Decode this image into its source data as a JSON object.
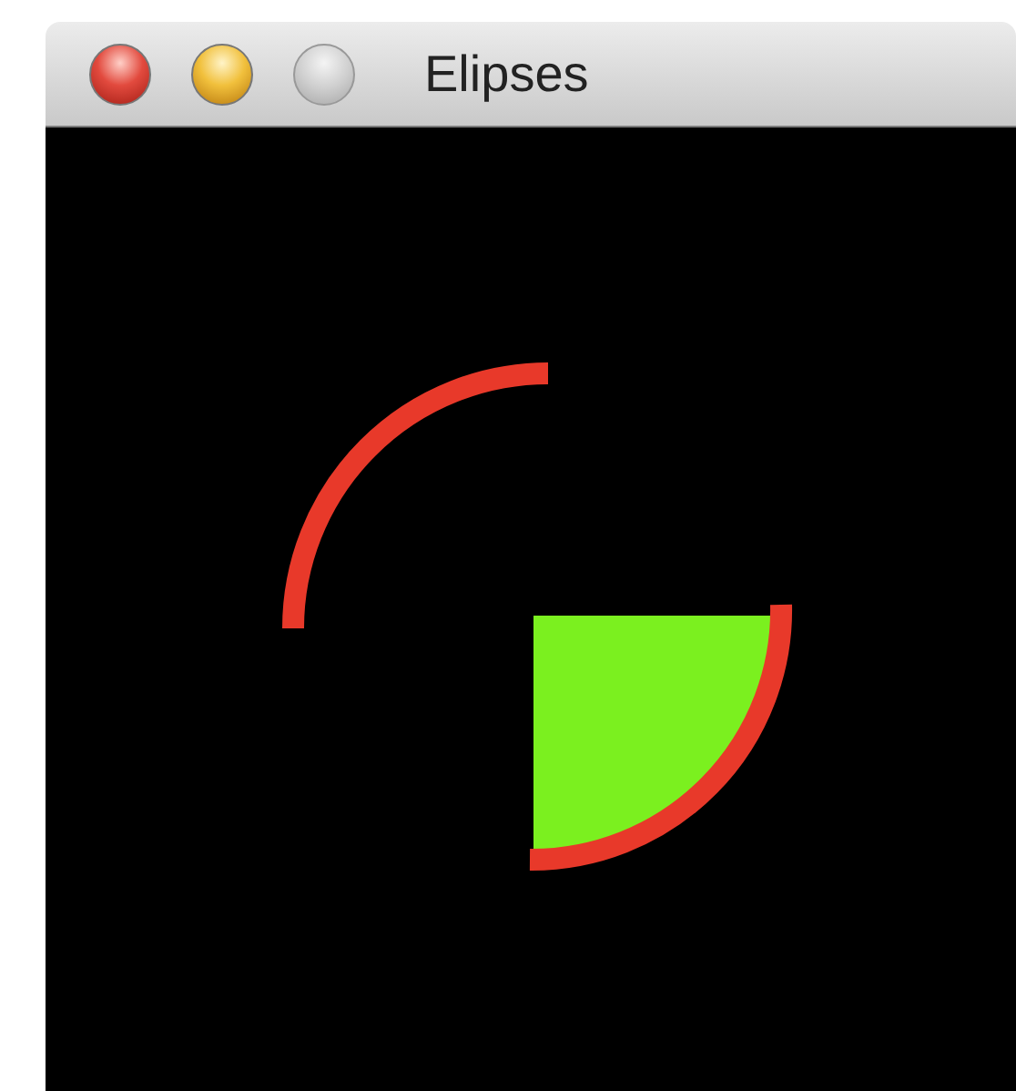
{
  "window": {
    "title": "Elipses"
  }
}
